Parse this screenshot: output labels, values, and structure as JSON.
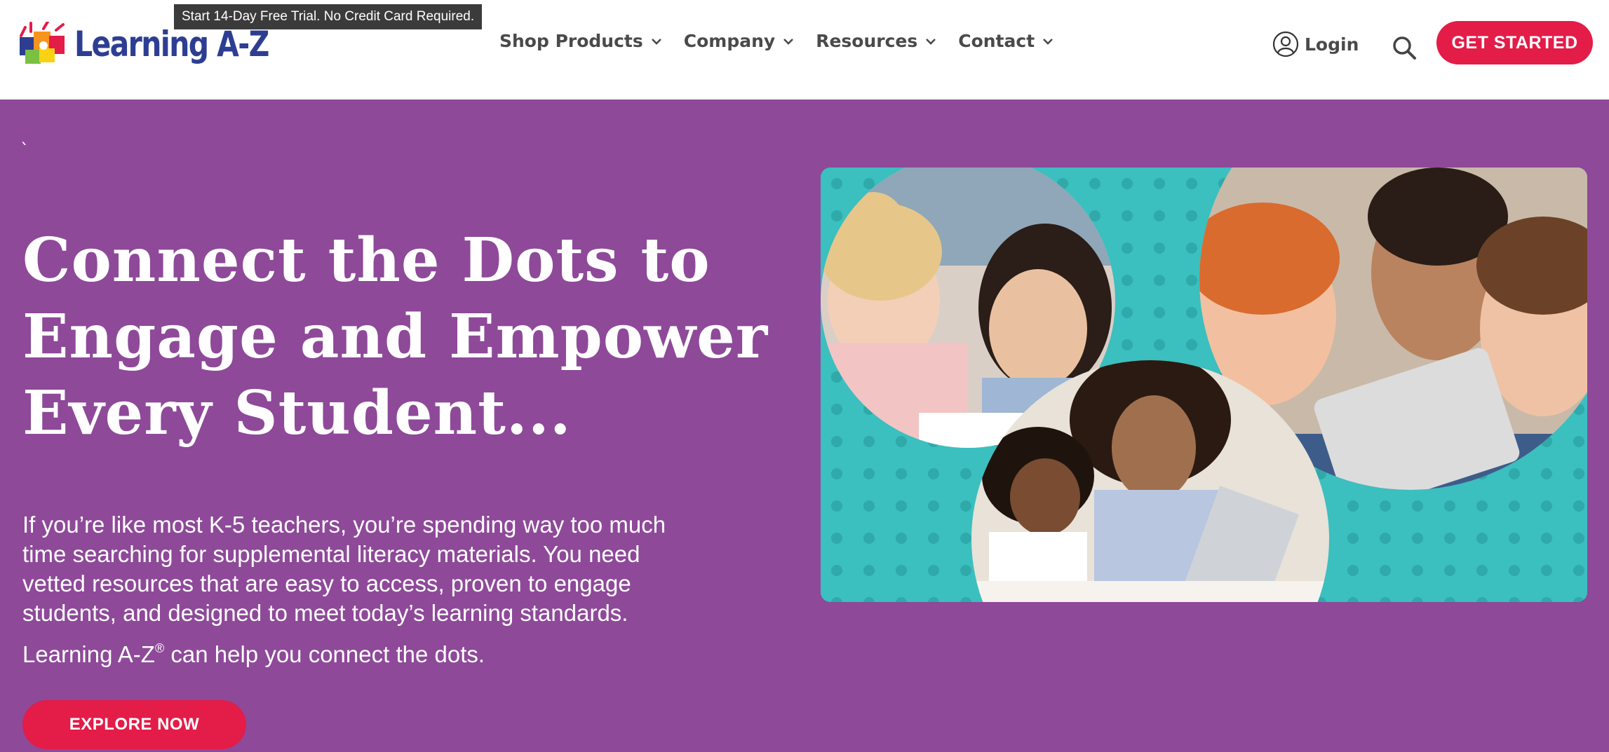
{
  "header": {
    "logo_text": "Learning A-Z",
    "tooltip": "Start 14-Day Free Trial. No Credit Card Required.",
    "nav": [
      {
        "label": "Shop Products",
        "icon": "chevron-down-icon"
      },
      {
        "label": "Company",
        "icon": "chevron-down-icon"
      },
      {
        "label": "Resources",
        "icon": "chevron-down-icon"
      },
      {
        "label": "Contact",
        "icon": "chevron-down-icon"
      }
    ],
    "login_label": "Login",
    "login_icon": "user-circle-icon",
    "search_icon": "search-icon",
    "cta_label": "GET STARTED"
  },
  "hero": {
    "backtick": "`",
    "headline_lines": [
      "Connect the Dots to",
      "Engage and Empower",
      "Every Student..."
    ],
    "body_lines": [
      "If you’re like most K-5 teachers, you’re spending way too much",
      "time searching for supplemental literacy materials. You need",
      "vetted resources that are easy to access, proven to engage",
      "students, and designed to meet today’s learning standards."
    ],
    "body_last_prefix": "Learning A-Z",
    "body_last_mark": "®",
    "body_last_suffix": " can help you connect the dots.",
    "cta_label": "EXPLORE NOW",
    "photo_alt": "Children and teacher learning together with tablets"
  },
  "colors": {
    "brand_purple": "#8e4999",
    "cta_red": "#e31c48",
    "logo_blue": "#2d3e92",
    "photo_teal": "#3bbfbf",
    "nav_text": "#4a4a4a"
  }
}
